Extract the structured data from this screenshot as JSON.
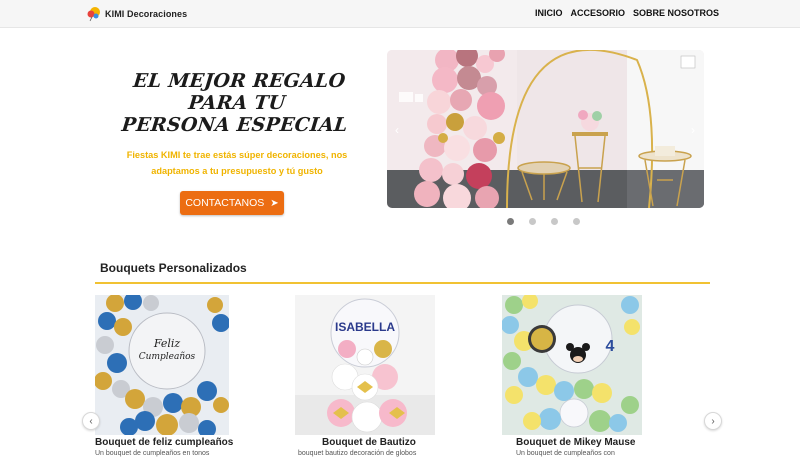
{
  "brand": {
    "name": "KIMI Decoraciones",
    "logo_icon": "balloon-logo-icon"
  },
  "nav": {
    "items": [
      {
        "label": "INICIO"
      },
      {
        "label": "ACCESORIO"
      },
      {
        "label": "SOBRE NOSOTROS"
      }
    ]
  },
  "hero": {
    "title_line1": "EL MEJOR REGALO PARA TU",
    "title_line2": "PERSONA ESPECIAL",
    "subtitle_line1": "Fiestas KIMI te trae estás súper decoraciones, nos",
    "subtitle_line2": "adaptamos a tu presupuesto y tú gusto",
    "cta_label": "CONTACTANOS",
    "cta_icon": "send-icon",
    "accent_color": "#ec6d12",
    "subtitle_color": "#f0b400"
  },
  "carousel": {
    "slide_count": 4,
    "active_index": 0
  },
  "bouquets": {
    "section_title": "Bouquets Personalizados",
    "items": [
      {
        "title": "Bouquet de feliz cumpleaños",
        "desc": "Un bouquet de cumpleaños en tonos",
        "balloon_text_1": "Feliz",
        "balloon_text_2": "Cumpleaños"
      },
      {
        "title": "Bouquet de Bautizo",
        "desc": "bouquet bautizo decoración de globos",
        "balloon_text_1": "ISABELLA"
      },
      {
        "title": "Bouquet de Mikey Mause",
        "desc": "Un bouquet de cumpleaños con",
        "balloon_text_1": "4"
      }
    ],
    "prev_icon": "chevron-left-icon",
    "next_icon": "chevron-right-icon",
    "line_color": "#f1c232"
  }
}
